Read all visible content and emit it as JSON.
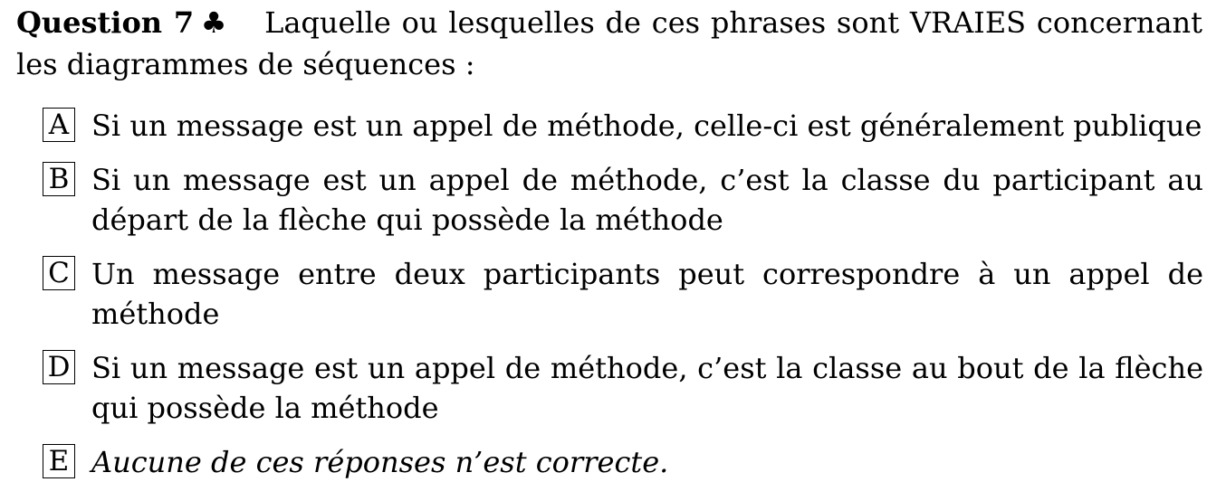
{
  "question": {
    "label": "Question 7",
    "symbol": "♣",
    "text": "Laquelle ou lesquelles de ces phrases sont VRAIES concernant les diagrammes de séquences :"
  },
  "choices": [
    {
      "letter": "A",
      "text": "Si un message est un appel de méthode, celle-ci est généralement publique"
    },
    {
      "letter": "B",
      "text": "Si un message est un appel de méthode, c’est la classe du participant au départ de la flèche qui possède la méthode"
    },
    {
      "letter": "C",
      "text": "Un message entre deux participants peut correspondre à un appel de méthode"
    },
    {
      "letter": "D",
      "text": "Si un message est un appel de méthode, c’est la classe au bout de la flèche qui possède la méthode"
    },
    {
      "letter": "E",
      "text": "Aucune de ces réponses n’est correcte."
    }
  ]
}
